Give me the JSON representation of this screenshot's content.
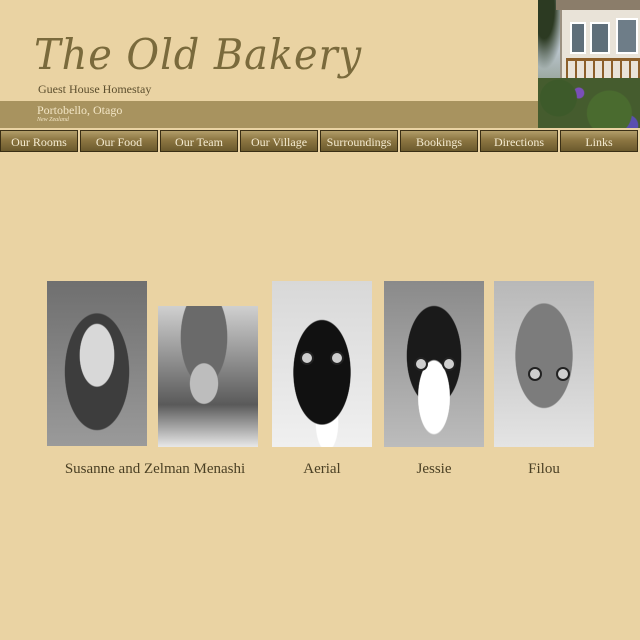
{
  "header": {
    "logo_title": "The Old Bakery",
    "logo_subtitle": "Guest House Homestay",
    "place": "Portobello, Otago",
    "country": "New Zealand"
  },
  "nav": {
    "items": [
      {
        "label": "Our Rooms"
      },
      {
        "label": "Our Food"
      },
      {
        "label": "Our Team"
      },
      {
        "label": "Our Village"
      },
      {
        "label": "Surroundings"
      },
      {
        "label": "Bookings"
      },
      {
        "label": "Directions"
      },
      {
        "label": "Links"
      }
    ]
  },
  "team": {
    "members": [
      {
        "caption": "Susanne and Zelman Menashi"
      },
      {
        "caption": "Aerial"
      },
      {
        "caption": "Jessie"
      },
      {
        "caption": "Filou"
      }
    ]
  },
  "colors": {
    "background": "#ead3a3",
    "band": "#a8935f",
    "nav_button": "#8c7642",
    "text": "#4b4024"
  }
}
